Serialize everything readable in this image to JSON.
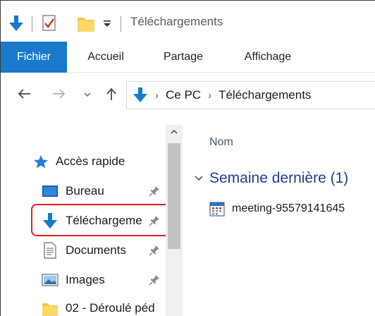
{
  "window": {
    "title": "Téléchargements"
  },
  "quick_access_toolbar": {
    "icons": [
      "download-arrow-icon",
      "properties-check-icon",
      "new-folder-icon",
      "customize-dropdown-icon"
    ]
  },
  "ribbon": {
    "tabs": [
      {
        "label": "Fichier",
        "active": true
      },
      {
        "label": "Accueil",
        "active": false
      },
      {
        "label": "Partage",
        "active": false
      },
      {
        "label": "Affichage",
        "active": false
      }
    ]
  },
  "address_bar": {
    "crumbs": [
      "Ce PC",
      "Téléchargements"
    ]
  },
  "nav_pane": {
    "items": [
      {
        "label": "Accès rapide",
        "icon": "star-icon",
        "pinned": false
      },
      {
        "label": "Bureau",
        "icon": "desktop-icon",
        "pinned": true
      },
      {
        "label": "Téléchargeme",
        "icon": "download-arrow-icon",
        "pinned": true,
        "highlighted": true
      },
      {
        "label": "Documents",
        "icon": "document-icon",
        "pinned": true
      },
      {
        "label": "Images",
        "icon": "images-icon",
        "pinned": true
      },
      {
        "label": "02 - Déroulé péd",
        "icon": "folder-icon",
        "pinned": false
      }
    ]
  },
  "content": {
    "column_header": "Nom",
    "group_header": "Semaine dernière (1)",
    "files": [
      {
        "name": "meeting-95579141645",
        "icon": "calendar-file-icon"
      }
    ]
  },
  "colors": {
    "accent": "#1979ca",
    "group_header": "#1e3f8f",
    "highlight_box": "#e02020"
  }
}
